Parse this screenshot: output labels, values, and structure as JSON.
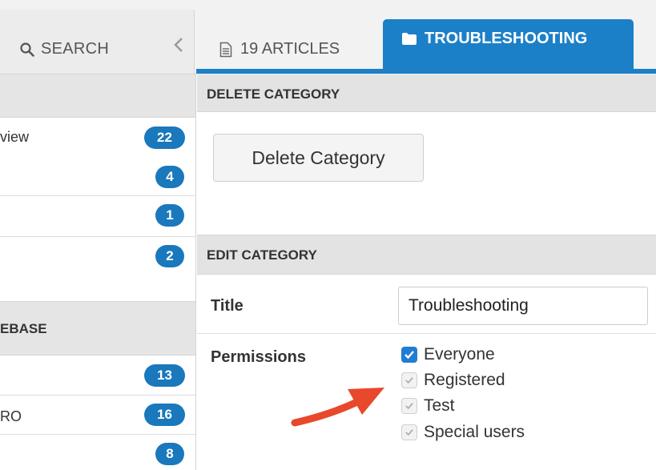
{
  "topbar": {
    "search_label": "SEARCH",
    "articles_tab_label": "19 ARTICLES",
    "active_tab_label": "TROUBLESHOOTING"
  },
  "sidebar": {
    "sections": [
      {
        "heading": "",
        "items": [
          {
            "label": "view",
            "count": "22"
          },
          {
            "label": "",
            "count": "4"
          },
          {
            "label": "",
            "count": "1"
          },
          {
            "label": "",
            "count": "2"
          }
        ]
      },
      {
        "heading": "EBASE",
        "items": [
          {
            "label": "",
            "count": "13"
          },
          {
            "label": "RO",
            "count": "16"
          },
          {
            "label": "",
            "count": "8"
          }
        ]
      }
    ]
  },
  "main": {
    "delete_section_heading": "DELETE CATEGORY",
    "delete_button_label": "Delete Category",
    "edit_section_heading": "EDIT CATEGORY",
    "title_label": "Title",
    "title_value": "Troubleshooting",
    "permissions_label": "Permissions",
    "permissions": [
      {
        "label": "Everyone",
        "checked": true
      },
      {
        "label": "Registered",
        "checked": false
      },
      {
        "label": "Test",
        "checked": false
      },
      {
        "label": "Special users",
        "checked": false
      }
    ]
  },
  "colors": {
    "accent": "#1b80c8",
    "badge": "#1a78bc",
    "annotation_arrow": "#e8482b",
    "section_header_bg": "#e3e3e3"
  },
  "icons": [
    "search-icon",
    "chevron-left-icon",
    "document-icon",
    "folder-icon",
    "checkmark-icon",
    "annotation-arrow"
  ]
}
